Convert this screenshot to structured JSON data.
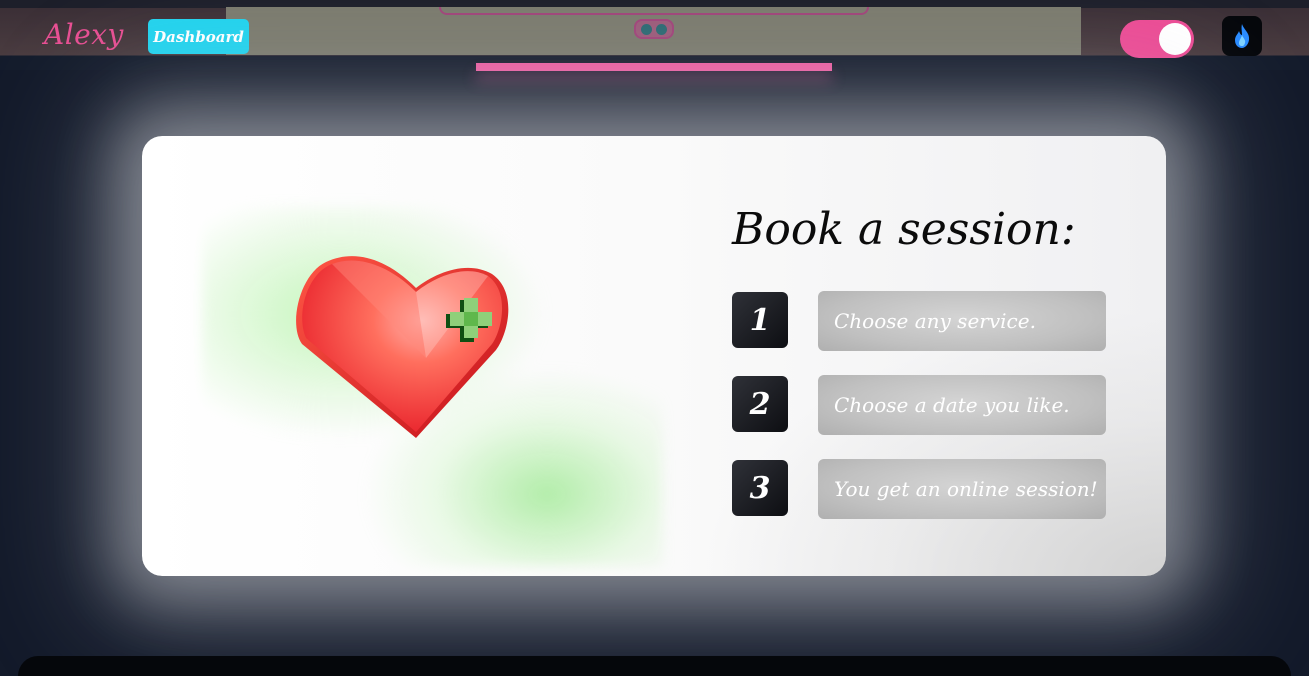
{
  "navbar": {
    "logo_text": "Alexy",
    "dashboard_label": "Dashboard",
    "theme_toggle_on": true,
    "flame_icon": "flame-icon"
  },
  "booking": {
    "title": "Book a session:",
    "illustration": "heart-with-plus-icon",
    "steps": [
      {
        "number": "1",
        "text": "Choose any service."
      },
      {
        "number": "2",
        "text": "Choose a date you like."
      },
      {
        "number": "3",
        "text": "You get an online session!"
      }
    ]
  },
  "colors": {
    "accent_pink": "#ec4c95",
    "accent_cyan": "#22d3ee",
    "background": "#131a2a",
    "heart_red": "#ff5a4a",
    "cross_green": "#1f7a1f"
  }
}
